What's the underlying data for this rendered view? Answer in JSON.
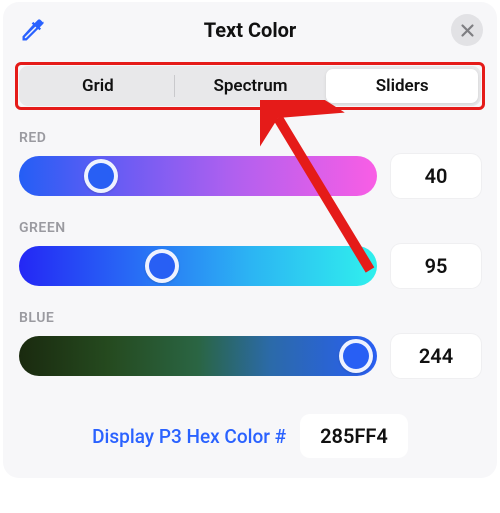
{
  "header": {
    "title": "Text Color"
  },
  "tabs": {
    "grid": "Grid",
    "spectrum": "Spectrum",
    "sliders": "Sliders",
    "selected": "Sliders"
  },
  "channels": {
    "red": {
      "label": "RED",
      "value": "40",
      "thumb_pct": 23,
      "thumb_color": "#285ff4"
    },
    "green": {
      "label": "GREEN",
      "value": "95",
      "thumb_pct": 40,
      "thumb_color": "#285ff4"
    },
    "blue": {
      "label": "BLUE",
      "value": "244",
      "thumb_pct": 94,
      "thumb_color": "#285ff4"
    }
  },
  "hex": {
    "label": "Display P3 Hex Color #",
    "value": "285FF4"
  },
  "annotation": {
    "arrow_color": "#e51b19"
  }
}
